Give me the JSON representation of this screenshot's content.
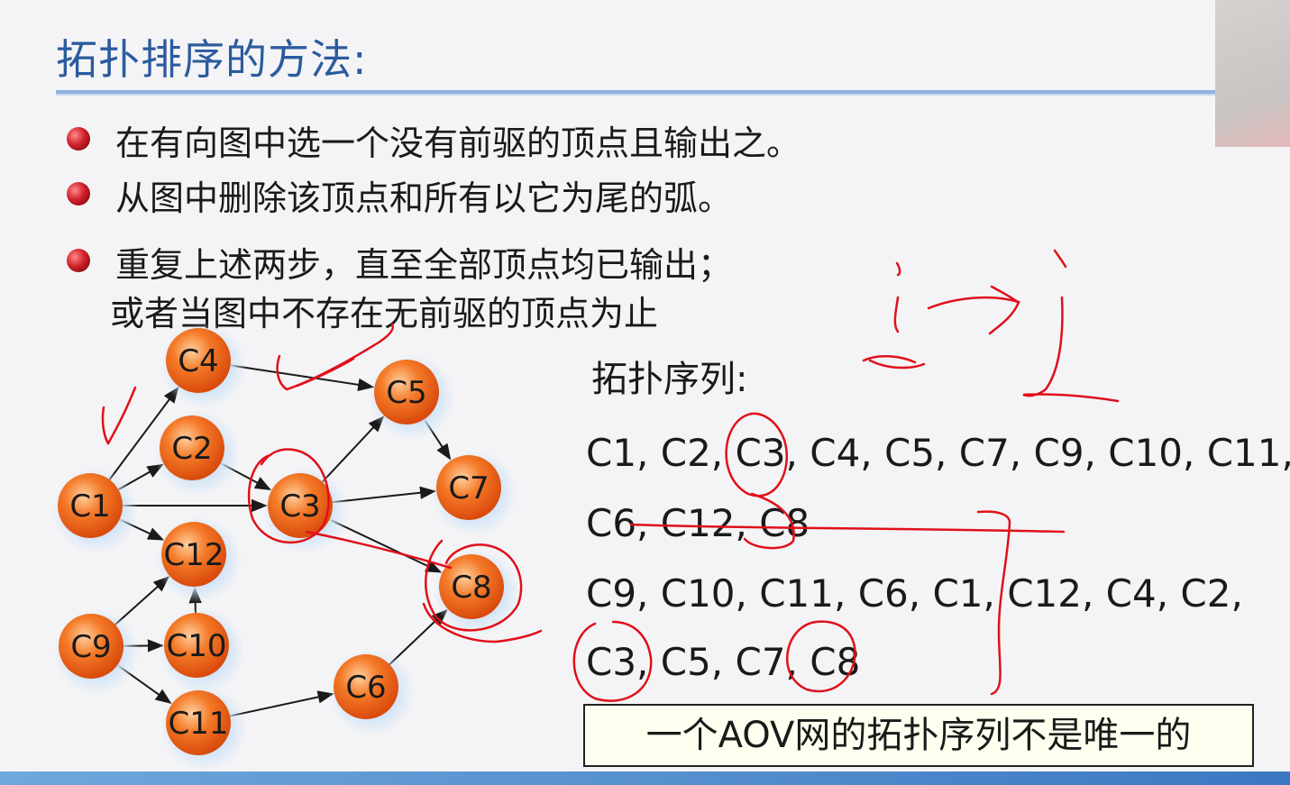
{
  "slide": {
    "title": "拓扑排序的方法:",
    "bullets": [
      "在有向图中选一个没有前驱的顶点且输出之。",
      "从图中删除该顶点和所有以它为尾的弧。",
      "重复上述两步，直至全部顶点均已输出；"
    ],
    "bullet3_cont": "或者当图中不存在无前驱的顶点为止",
    "sequence_label": "拓扑序列:",
    "sequences": [
      "C1, C2, C3, C4, C5, C7, C9, C10,  C11,",
      "C6, C12, C8",
      "C9, C10, C11, C6, C1, C12, C4, C2,",
      "C3, C5, C7, C8"
    ],
    "note": "一个AOV网的拓扑序列不是唯一的"
  },
  "graph": {
    "nodes": [
      "C1",
      "C2",
      "C3",
      "C4",
      "C5",
      "C6",
      "C7",
      "C8",
      "C9",
      "C10",
      "C11",
      "C12"
    ],
    "edges": [
      [
        "C1",
        "C4"
      ],
      [
        "C1",
        "C2"
      ],
      [
        "C1",
        "C3"
      ],
      [
        "C1",
        "C12"
      ],
      [
        "C2",
        "C3"
      ],
      [
        "C4",
        "C5"
      ],
      [
        "C3",
        "C5"
      ],
      [
        "C3",
        "C7"
      ],
      [
        "C3",
        "C8"
      ],
      [
        "C5",
        "C7"
      ],
      [
        "C9",
        "C12"
      ],
      [
        "C9",
        "C10"
      ],
      [
        "C9",
        "C11"
      ],
      [
        "C10",
        "C12"
      ],
      [
        "C11",
        "C6"
      ],
      [
        "C6",
        "C8"
      ]
    ]
  },
  "colors": {
    "title": "#2b5b9e",
    "node_fill": "#f06a1e",
    "ink": "#e0101a"
  }
}
